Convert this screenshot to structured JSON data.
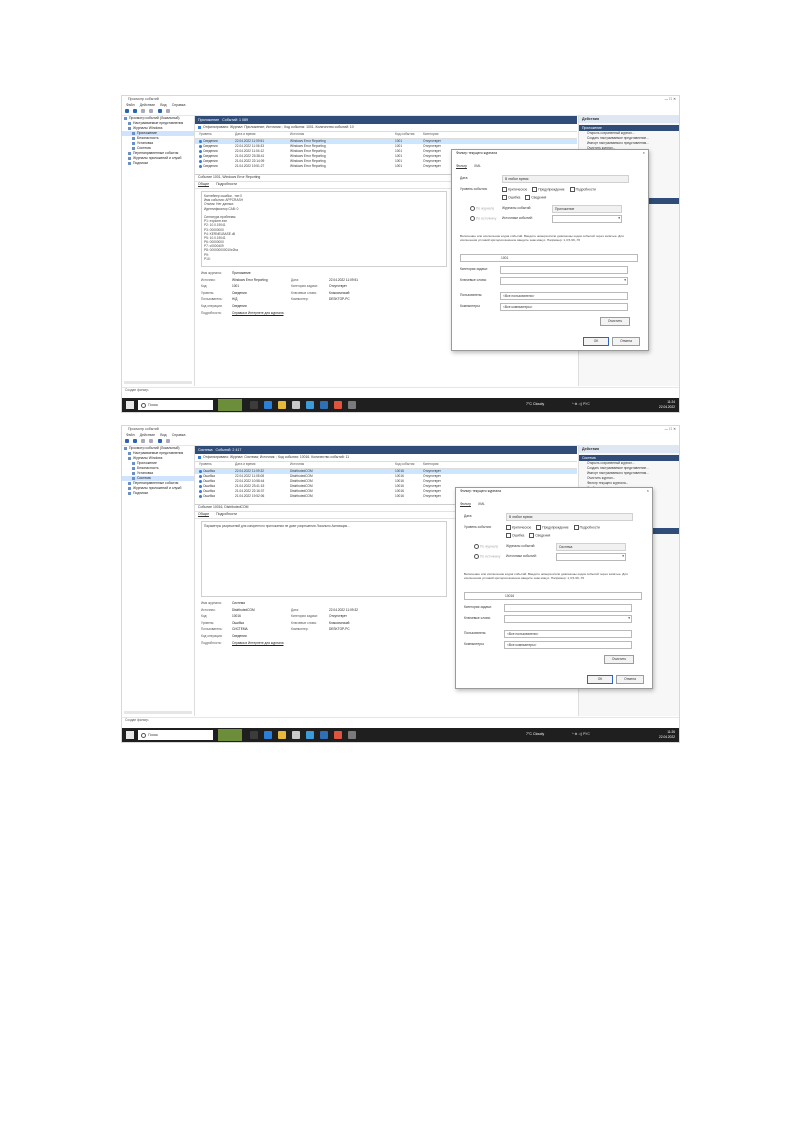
{
  "screens": [
    {
      "window_title": "Просмотр событий",
      "menu": [
        "Файл",
        "Действие",
        "Вид",
        "Справка"
      ],
      "tree": [
        {
          "label": "Просмотр событий (Локальный)",
          "selected": false
        },
        {
          "label": "Настраиваемые представления",
          "selected": false
        },
        {
          "label": "Журналы Windows",
          "selected": false
        },
        {
          "label": "Приложение",
          "selected": true
        },
        {
          "label": "Безопасность",
          "selected": false
        },
        {
          "label": "Установка",
          "selected": false
        },
        {
          "label": "Система",
          "selected": false
        },
        {
          "label": "Перенаправленные события",
          "selected": false
        },
        {
          "label": "Журналы приложений и служб",
          "selected": false
        },
        {
          "label": "Подписки",
          "selected": false
        }
      ],
      "log_name": "Приложение",
      "log_count": "Событий: 1 089",
      "filter_text": "Отфильтровано: Журнал: Приложение; Источник: ; Код события: 1001. Количество событий: 10",
      "columns": [
        "Уровень",
        "Дата и время",
        "Источник",
        "Код события",
        "Категория"
      ],
      "rows": [
        [
          "Сведения",
          "22.04.2022 11:09:51",
          "Windows Error Reporting",
          "1001",
          "Отсутствует"
        ],
        [
          "Сведения",
          "22.04.2022 11:06:33",
          "Windows Error Reporting",
          "1001",
          "Отсутствует"
        ],
        [
          "Сведения",
          "22.04.2022 11:04:12",
          "Windows Error Reporting",
          "1001",
          "Отсутствует"
        ],
        [
          "Сведения",
          "21.04.2022 23:38:41",
          "Windows Error Reporting",
          "1001",
          "Отсутствует"
        ],
        [
          "Сведения",
          "21.04.2022 22:14:09",
          "Windows Error Reporting",
          "1001",
          "Отсутствует"
        ],
        [
          "Сведения",
          "21.04.2022 19:51:27",
          "Windows Error Reporting",
          "1001",
          "Отсутствует"
        ]
      ],
      "detail_title": "Событие 1001, Windows Error Reporting",
      "tabs": [
        "Общие",
        "Подробности"
      ],
      "detail_lines": [
        "Контейнер ошибки , тип 0",
        "Имя события: APPCRASH",
        "Отклик: Нет данных",
        "Идентификатор CAB: 0",
        "",
        "Сигнатура проблемы:",
        "P1: explorer.exe",
        "P2: 10.0.19041",
        "P3: 00000000",
        "P4: KERNELBASE.dll",
        "P5: 10.0.19041",
        "P6: 00000000",
        "P7: c0000409",
        "P8: 000000000010e2ba",
        "P9:",
        "P10:"
      ],
      "props": [
        [
          "Имя журнала:",
          "Приложение",
          "",
          ""
        ],
        [
          "Источник:",
          "Windows Error Reporting",
          "Дата:",
          "22.04.2022 11:09:51"
        ],
        [
          "Код:",
          "1001",
          "Категория задачи:",
          "Отсутствует"
        ],
        [
          "Уровень:",
          "Сведения",
          "Ключевые слова:",
          "Классический"
        ],
        [
          "Пользователь:",
          "Н/Д",
          "Компьютер:",
          "DESKTOP-PC"
        ],
        [
          "Код операции:",
          "Сведения",
          "",
          ""
        ]
      ],
      "more_info_label": "Подробности:",
      "more_info_link": "Справка в Интернете для журнала",
      "actions_title": "Действия",
      "actions_sections": [
        "Приложение",
        "Событие 1001, Windows Error Reporting"
      ],
      "actions_items_a": [
        "Открыть сохраненный журнал...",
        "Создать настраиваемое представление...",
        "Импорт настраиваемого представления...",
        "Очистить журнал...",
        "Фильтр текущего журнала...",
        "Свойства",
        "Найти...",
        "Сохранить отфильтрованные события...",
        "Прикрепить задачу к этому журналу...",
        "Очистить фильтр",
        "Вид",
        "Обновить",
        "Справка"
      ],
      "actions_items_b": [
        "Свойства события",
        "Прикрепить задачу к этому событию...",
        "Копировать",
        "Сохранить выбранные события...",
        "Обновить",
        "Справка"
      ],
      "status_text": "Создан фильтр.",
      "search_placeholder": "Поиск",
      "weather": "7°C Cloudy",
      "tray_text": "^ ⊕ ◁) РУС",
      "time": "11:24",
      "date": "22.04.2022",
      "dialog": {
        "title": "Фильтр текущего журнала",
        "tabs": [
          "Фильтр",
          "XML"
        ],
        "date_label": "Дата:",
        "date_value": "В любое время",
        "level_label": "Уровень события:",
        "levels_row1": [
          "Критическое",
          "Предупреждение",
          "Подробности"
        ],
        "levels_row2": [
          "Ошибка",
          "Сведения"
        ],
        "by_log_label": "По журналу",
        "by_source_label": "По источнику",
        "event_logs_label": "Журналы событий:",
        "event_logs_value": "Приложение",
        "sources_label": "Источники событий:",
        "sources_value": "",
        "desc": "Включение или исключение кодов событий. Введите номера и/или диапазоны кодов событий через запятые. Для исключения условий критерия вначале введите знак минус. Например: 1,3,5-99,-76",
        "event_id_value": "1001",
        "task_label": "Категория задачи:",
        "keywords_label": "Ключевые слова:",
        "user_label": "Пользователь:",
        "user_value": "<Все пользователи>",
        "computer_label": "Компьютеры:",
        "computer_value": "<Все компьютеры>",
        "clear_button": "Очистить",
        "ok_button": "ОК",
        "cancel_button": "Отмена"
      }
    },
    {
      "window_title": "Просмотр событий",
      "menu": [
        "Файл",
        "Действие",
        "Вид",
        "Справка"
      ],
      "tree": [
        {
          "label": "Просмотр событий (Локальный)",
          "selected": false
        },
        {
          "label": "Настраиваемые представления",
          "selected": false
        },
        {
          "label": "Журналы Windows",
          "selected": false
        },
        {
          "label": "Приложение",
          "selected": false
        },
        {
          "label": "Безопасность",
          "selected": false
        },
        {
          "label": "Установка",
          "selected": false
        },
        {
          "label": "Система",
          "selected": true
        },
        {
          "label": "Перенаправленные события",
          "selected": false
        },
        {
          "label": "Журналы приложений и служб",
          "selected": false
        },
        {
          "label": "Подписки",
          "selected": false
        }
      ],
      "log_name": "Система",
      "log_count": "Событий: 2 417",
      "filter_text": "Отфильтровано: Журнал: Система; Источник: ; Код события: 10016. Количество событий: 11",
      "columns": [
        "Уровень",
        "Дата и время",
        "Источник",
        "Код события",
        "Категория"
      ],
      "rows": [
        [
          "Ошибка",
          "22.04.2022 11:09:32",
          "DistributedCOM",
          "10016",
          "Отсутствует"
        ],
        [
          "Ошибка",
          "22.04.2022 11:05:08",
          "DistributedCOM",
          "10016",
          "Отсутствует"
        ],
        [
          "Ошибка",
          "22.04.2022 10:58:44",
          "DistributedCOM",
          "10016",
          "Отсутствует"
        ],
        [
          "Ошибка",
          "21.04.2022 23:41:15",
          "DistributedCOM",
          "10016",
          "Отсутствует"
        ],
        [
          "Ошибка",
          "21.04.2022 22:16:37",
          "DistributedCOM",
          "10016",
          "Отсутствует"
        ],
        [
          "Ошибка",
          "21.04.2022 19:52:06",
          "DistributedCOM",
          "10016",
          "Отсутствует"
        ]
      ],
      "detail_title": "Событие 10016, DistributedCOM",
      "tabs": [
        "Общие",
        "Подробности"
      ],
      "detail_lines": [
        "Параметры разрешений для конкретного приложения не дают разрешения Локально Активация..."
      ],
      "props": [
        [
          "Имя журнала:",
          "Система",
          "",
          ""
        ],
        [
          "Источник:",
          "DistributedCOM",
          "Дата:",
          "22.04.2022 11:09:32"
        ],
        [
          "Код:",
          "10016",
          "Категория задачи:",
          "Отсутствует"
        ],
        [
          "Уровень:",
          "Ошибка",
          "Ключевые слова:",
          "Классический"
        ],
        [
          "Пользователь:",
          "СИСТЕМА",
          "Компьютер:",
          "DESKTOP-PC"
        ],
        [
          "Код операции:",
          "Сведения",
          "",
          ""
        ]
      ],
      "more_info_label": "Подробности:",
      "more_info_link": "Справка в Интернете для журнала",
      "actions_title": "Действия",
      "actions_sections": [
        "Система",
        "Событие 10016, DistributedCOM"
      ],
      "actions_items_a": [
        "Открыть сохраненный журнал...",
        "Создать настраиваемое представление...",
        "Импорт настраиваемого представления...",
        "Очистить журнал...",
        "Фильтр текущего журнала...",
        "Свойства",
        "Найти...",
        "Сохранить отфильтрованные события...",
        "Прикрепить задачу к этому журналу...",
        "Очистить фильтр",
        "Вид",
        "Обновить",
        "Справка"
      ],
      "actions_items_b": [
        "Свойства события",
        "Прикрепить задачу к этому событию...",
        "Копировать",
        "Сохранить выбранные события...",
        "Обновить",
        "Справка"
      ],
      "status_text": "Создан фильтр.",
      "search_placeholder": "Поиск",
      "weather": "7°C Cloudy",
      "tray_text": "^ ⊕ ◁) РУС",
      "time": "11:26",
      "date": "22.04.2022",
      "dialog": {
        "title": "Фильтр текущего журнала",
        "tabs": [
          "Фильтр",
          "XML"
        ],
        "date_label": "Дата:",
        "date_value": "В любое время",
        "level_label": "Уровень события:",
        "levels_row1": [
          "Критическое",
          "Предупреждение",
          "Подробности"
        ],
        "levels_row2": [
          "Ошибка",
          "Сведения"
        ],
        "by_log_label": "По журналу",
        "by_source_label": "По источнику",
        "event_logs_label": "Журналы событий:",
        "event_logs_value": "Система",
        "sources_label": "Источники событий:",
        "sources_value": "",
        "desc": "Включение или исключение кодов событий. Введите номера и/или диапазоны кодов событий через запятые. Для исключения условий критерия вначале введите знак минус. Например: 1,3,5-99,-76",
        "event_id_value": "10016",
        "task_label": "Категория задачи:",
        "keywords_label": "Ключевые слова:",
        "user_label": "Пользователь:",
        "user_value": "<Все пользователи>",
        "computer_label": "Компьютеры:",
        "computer_value": "<Все компьютеры>",
        "clear_button": "Очистить",
        "ok_button": "ОК",
        "cancel_button": "Отмена"
      }
    }
  ],
  "colors": {
    "header_blue": "#2f4d78",
    "selection": "#cde6ff",
    "taskbar": "#1f1f1f",
    "link": "#1b5bd3"
  }
}
